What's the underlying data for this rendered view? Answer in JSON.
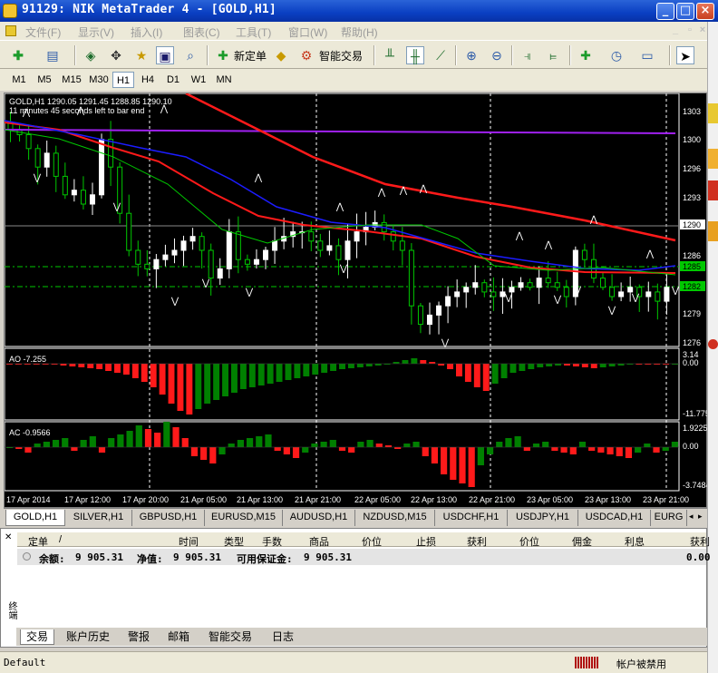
{
  "window": {
    "title": "91129: NIK MetaTrader 4 - [GOLD,H1]",
    "buttons": {
      "minimize": "_",
      "maximize": "□",
      "close": "×"
    }
  },
  "menu": {
    "items": [
      "文件(F)",
      "显示(V)",
      "插入(I)",
      "图表(C)",
      "工具(T)",
      "窗口(W)",
      "帮助(H)"
    ]
  },
  "toolbar": {
    "new_order": "新定单",
    "expert_advisors": "智能交易"
  },
  "timeframes": {
    "items": [
      "M1",
      "M5",
      "M15",
      "M30",
      "H1",
      "H4",
      "D1",
      "W1",
      "MN"
    ],
    "active": "H1"
  },
  "chart": {
    "header_line1": "GOLD,H1  1290.05 1291.45 1288.85 1290.10",
    "header_line2": "11 minutes 45 seconds left to bar end",
    "price_labels": [
      "1303",
      "1300",
      "1296",
      "1293",
      "1290",
      "1286",
      "1285",
      "1282",
      "1279",
      "1276"
    ],
    "current_price": "1290",
    "ao_label": "AO -7.255",
    "ao_scale": [
      "3.14",
      "0.00",
      "-11.775"
    ],
    "ac_label": "AC -0.9566",
    "ac_scale": [
      "1.9225",
      "0.00",
      "-3.7484"
    ],
    "time_labels": [
      "17 Apr 2014",
      "17 Apr 12:00",
      "17 Apr 20:00",
      "21 Apr 05:00",
      "21 Apr 13:00",
      "21 Apr 21:00",
      "22 Apr 05:00",
      "22 Apr 13:00",
      "22 Apr 21:00",
      "23 Apr 05:00",
      "23 Apr 13:00",
      "23 Apr 21:00"
    ],
    "colors": {
      "bull": "#ffffff",
      "bear": "#00c800",
      "ma_red": "#ff1a1a",
      "ma_blue": "#1c1cff",
      "ma_purple": "#a020f0",
      "ma_green": "#00c800",
      "ao_green": "#008000",
      "ao_red": "#ff1a1a"
    }
  },
  "symbol_tabs": {
    "items": [
      "GOLD,H1",
      "SILVER,H1",
      "GBPUSD,H1",
      "EURUSD,M15",
      "AUDUSD,H1",
      "NZDUSD,M15",
      "USDCHF,H1",
      "USDJPY,H1",
      "USDCAD,H1",
      "EURG"
    ],
    "active": "GOLD,H1"
  },
  "terminal": {
    "columns": [
      "定单",
      "/",
      "时间",
      "类型",
      "手数",
      "商品",
      "价位",
      "止损",
      "获利",
      "价位",
      "佣金",
      "利息",
      "获利"
    ],
    "balance_label": "余额:",
    "balance_value": "9 905.31",
    "equity_label": "净值:",
    "equity_value": "9 905.31",
    "free_margin_label": "可用保证金:",
    "free_margin_value": "9 905.31",
    "profit_value": "0.00",
    "side_label": "终端",
    "tabs": [
      "交易",
      "账户历史",
      "警报",
      "邮箱",
      "智能交易",
      "日志"
    ],
    "active_tab": "交易"
  },
  "status": {
    "profile": "Default",
    "connection": "帐户被禁用"
  }
}
